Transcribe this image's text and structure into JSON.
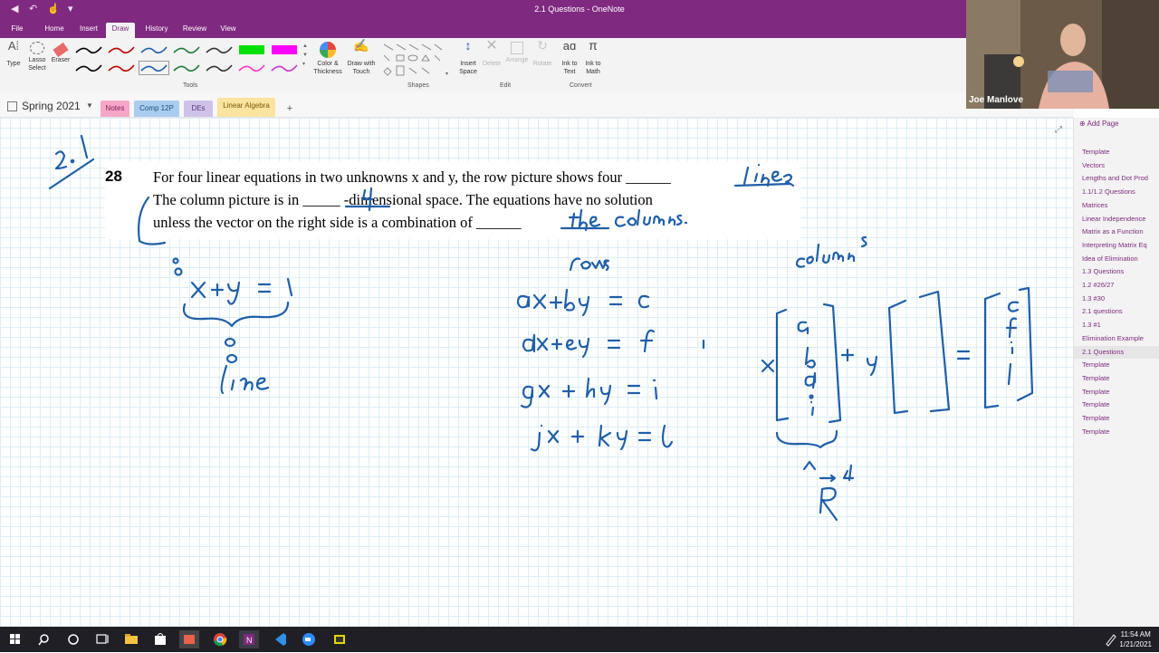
{
  "window": {
    "title": "2.1 Questions  -  OneNote"
  },
  "ribbon": {
    "tabs": [
      "File",
      "Home",
      "Insert",
      "Draw",
      "History",
      "Review",
      "View"
    ],
    "active_tab": "Draw",
    "type_label": "Type",
    "lasso_label": "Lasso Select",
    "eraser_label": "Eraser",
    "tools_group": "Tools",
    "color_label": "Color & Thickness",
    "draw_touch_label": "Draw with Touch",
    "shapes_group": "Shapes",
    "insert_space_label": "Insert Space",
    "delete_label": "Delete",
    "arrange_label": "Arrange",
    "rotate_label": "Rotate",
    "edit_group": "Edit",
    "ink_text_label": "Ink to Text",
    "ink_math_label": "Ink to Math",
    "convert_group": "Convert",
    "pens": [
      {
        "color": "#000000"
      },
      {
        "color": "#c00000"
      },
      {
        "color": "#1f5fa8"
      },
      {
        "color": "#1e7b3c"
      },
      {
        "color": "#333333"
      },
      {
        "color": "#00e000"
      },
      {
        "color": "#ff00ff"
      },
      {
        "color": "#000000"
      },
      {
        "color": "#c00000"
      },
      {
        "color": "#1f5fa8"
      },
      {
        "color": "#1e7b3c"
      },
      {
        "color": "#333333"
      },
      {
        "color": "#ff33cc"
      },
      {
        "color": "#cc33cc"
      }
    ]
  },
  "notebook": {
    "name": "Spring 2021",
    "sections": [
      {
        "label": "Notes",
        "color": "#f7a6c8",
        "text": "#7a1f4d"
      },
      {
        "label": "Comp 12P",
        "color": "#a9cdee",
        "text": "#1e4e7a"
      },
      {
        "label": "DEs",
        "color": "#cfc2e8",
        "text": "#4b3a7a"
      },
      {
        "label": "Linear Algebra",
        "color": "#fbe3a0",
        "text": "#7a5a00"
      }
    ],
    "add_section": "+"
  },
  "problem": {
    "number": "28",
    "line1": "For four linear equations in two unknowns x and y, the row picture shows four ______",
    "line2": "The column picture is in _____ -dimensional space.  The equations have no solution",
    "line3": "unless the vector on the right side is a combination of ______"
  },
  "pages": {
    "add_page": "Add Page",
    "items": [
      "Template",
      "Vectors",
      "Lengths and Dot Prod",
      "1.1/1.2 Questions",
      "Matrices",
      "Linear Independence",
      "Matrix as a Function",
      "Interpreting Matrix Eq",
      "Idea of Elimination",
      "1.3 Questions",
      "1.2 #26/27",
      "1.3 #30",
      "2.1 questions",
      "1.3 #1",
      "Elimination Example",
      "2.1 Questions",
      "Template",
      "Template",
      "Template",
      "Template",
      "Template",
      "Template"
    ],
    "active_index": 15
  },
  "webcam": {
    "name": "Joe Manlove"
  },
  "taskbar": {
    "time": "11:54 AM",
    "date": "1/21/2021"
  },
  "colors": {
    "onenote_purple": "#7f2980",
    "ink_blue": "#1f5fa8"
  }
}
